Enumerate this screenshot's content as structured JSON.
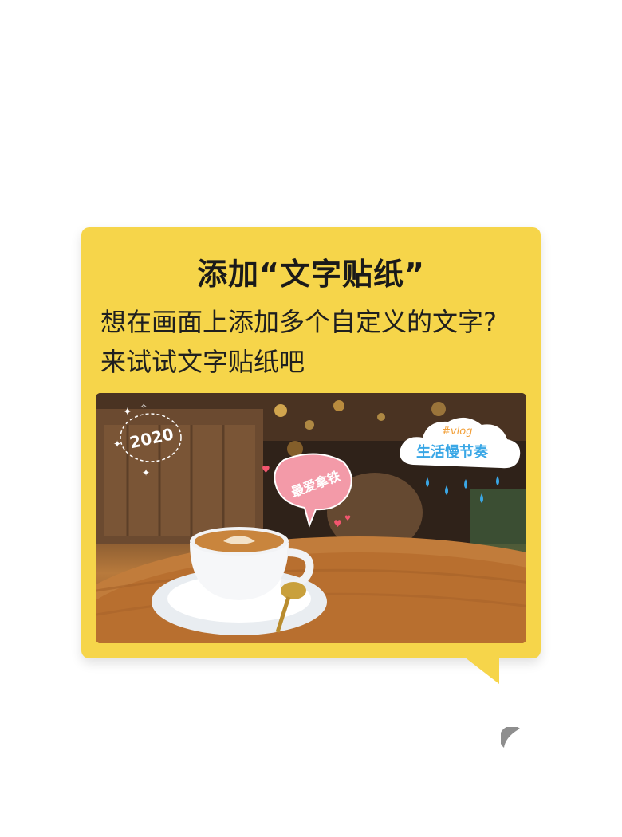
{
  "card": {
    "title": "添加“文字贴纸”",
    "description_line1": "想在画面上添加多个自定义的文字?",
    "description_line2": "来试试文字贴纸吧"
  },
  "photo": {
    "sticker_year": "2020",
    "sticker_bubble": "最爱拿铁",
    "sticker_cloud_tag": "#vlog",
    "sticker_cloud_text": "生活慢节奏"
  },
  "colors": {
    "card_background": "#f6d54a",
    "bubble_pink": "#f39aa8",
    "cloud_text_blue": "#3aa7e6",
    "tag_orange": "#f2a03a"
  }
}
